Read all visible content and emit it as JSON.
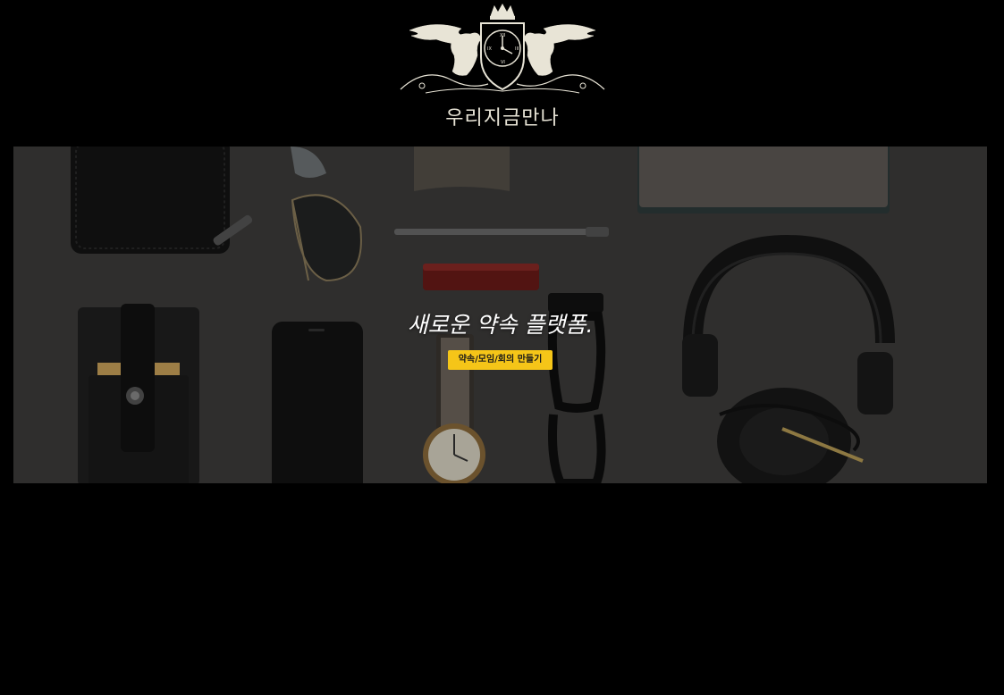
{
  "brand": {
    "name": "우리지금만나",
    "logo_icon": "crest-clock-griffins-icon"
  },
  "hero": {
    "title": "새로운 약속 플랫폼.",
    "cta_label": "약속/모임/회의 만들기",
    "background_image": "flat-lay-accessories-photo"
  },
  "colors": {
    "page_background": "#000000",
    "accent": "#f5c518",
    "logo": "#e8e4d6",
    "hero_text": "#ffffff"
  }
}
